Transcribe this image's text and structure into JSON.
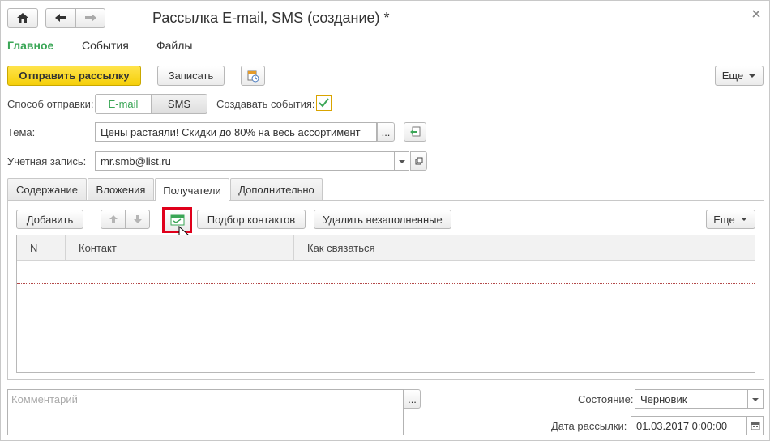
{
  "window": {
    "title": "Рассылка E-mail, SMS (создание) *"
  },
  "nav": {
    "home_icon": "home-icon",
    "back_icon": "arrow-left-icon",
    "forward_icon": "arrow-right-icon"
  },
  "sections": [
    {
      "label": "Главное",
      "active": true
    },
    {
      "label": "События",
      "active": false
    },
    {
      "label": "Файлы",
      "active": false
    }
  ],
  "toolbar": {
    "send_label": "Отправить рассылку",
    "save_label": "Записать",
    "more_label": "Еще"
  },
  "send_method": {
    "label": "Способ отправки:",
    "options": [
      "E-mail",
      "SMS"
    ],
    "selected": "E-mail"
  },
  "create_events": {
    "label": "Создавать события:",
    "checked": true
  },
  "subject": {
    "label": "Тема:",
    "value": "Цены растаяли! Скидки до 80% на весь ассортимент",
    "select_label": "..."
  },
  "account": {
    "label": "Учетная запись:",
    "value": "mr.smb@list.ru"
  },
  "tabs": [
    {
      "label": "Содержание",
      "active": false
    },
    {
      "label": "Вложения",
      "active": false
    },
    {
      "label": "Получатели",
      "active": true
    },
    {
      "label": "Дополнительно",
      "active": false
    }
  ],
  "recipients_toolbar": {
    "add_label": "Добавить",
    "pick_contacts_label": "Подбор контактов",
    "remove_empty_label": "Удалить незаполненные",
    "more_label": "Еще"
  },
  "table": {
    "columns": [
      "N",
      "Контакт",
      "Как связаться"
    ],
    "rows": []
  },
  "comment": {
    "placeholder": "Комментарий",
    "select_label": "..."
  },
  "status": {
    "label": "Состояние:",
    "value": "Черновик"
  },
  "send_date": {
    "label": "Дата рассылки:",
    "value": "01.03.2017  0:00:00"
  },
  "colors": {
    "accent_green": "#3aa656",
    "send_button": "#f5cf0a",
    "highlight_red": "#e0001b"
  }
}
